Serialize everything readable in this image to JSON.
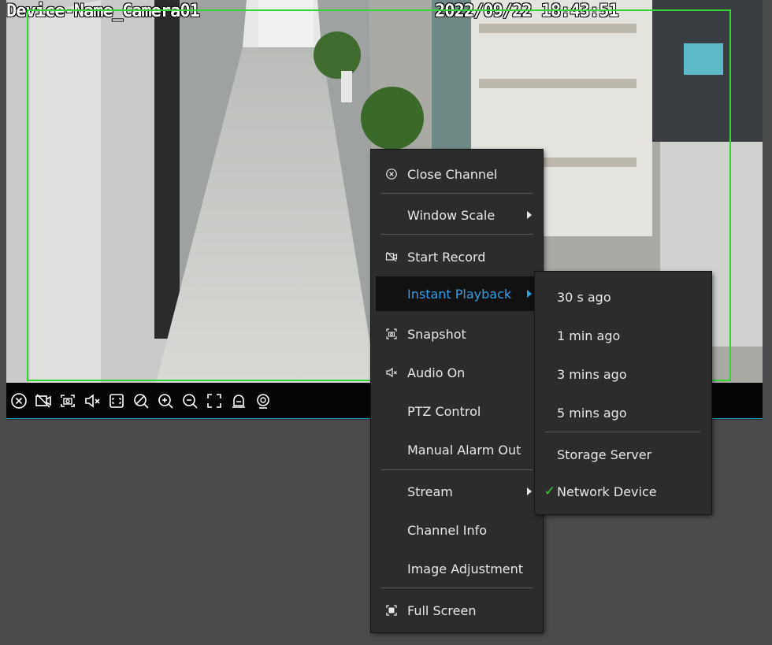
{
  "osd": {
    "device_name": "Device-Name_Camera01",
    "timestamp": "2022/09/22 18:43:51"
  },
  "toolbar": {
    "icons": [
      "close-channel-icon",
      "record-icon",
      "snapshot-icon",
      "audio-mute-icon",
      "zoom-region-icon",
      "privacy-icon",
      "zoom-in-icon",
      "zoom-out-icon",
      "fullscreen-icon",
      "alarm-out-icon",
      "ptz-icon"
    ]
  },
  "context_menu": {
    "close_channel": "Close Channel",
    "window_scale": "Window Scale",
    "start_record": "Start Record",
    "instant_playback": "Instant Playback",
    "snapshot": "Snapshot",
    "audio_on": "Audio On",
    "ptz_control": "PTZ Control",
    "manual_alarm_out": "Manual Alarm Out",
    "stream": "Stream",
    "channel_info": "Channel Info",
    "image_adjustment": "Image Adjustment",
    "full_screen": "Full Screen"
  },
  "playback_submenu": {
    "items": [
      "30 s ago",
      "1 min ago",
      "3 mins ago",
      "5 mins ago"
    ],
    "storage_server": "Storage Server",
    "network_device": "Network Device",
    "selected": "Network Device",
    "check_mark": "✓"
  },
  "colors": {
    "menu_bg": "#2c2c2c",
    "active_text": "#2f9fe6",
    "motion_box": "#34d534",
    "check": "#3cc93c"
  }
}
